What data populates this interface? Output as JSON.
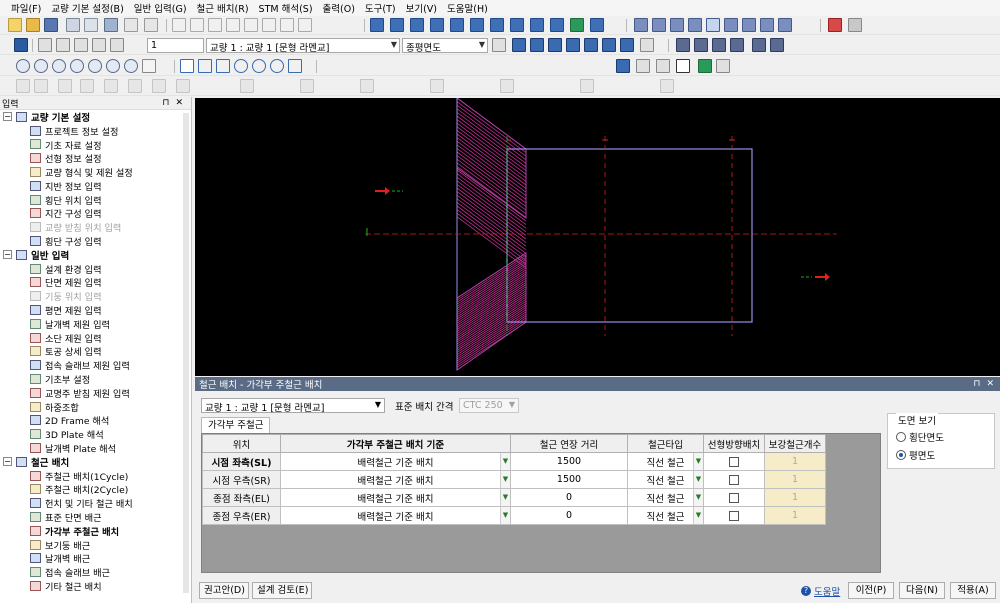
{
  "menubar": [
    "파일(F)",
    "교량 기본 설정(B)",
    "일반 입력(G)",
    "철근 배치(R)",
    "STM 해석(S)",
    "출력(O)",
    "도구(T)",
    "보기(V)",
    "도움말(H)"
  ],
  "toolbar2": {
    "number_value": "1",
    "bridge_select": "교량 1 : 교량 1 [문형 라멘교]",
    "view_select": "종평면도"
  },
  "left_panel": {
    "title": "입력",
    "groups": [
      {
        "label": "교량 기본 설정",
        "items": [
          {
            "label": "프로젝트 정보 설정",
            "disabled": false,
            "bold": false
          },
          {
            "label": "기초 자료 설정",
            "disabled": false,
            "bold": false
          },
          {
            "label": "선형 정보 설정",
            "disabled": false,
            "bold": false
          },
          {
            "label": "교량 형식 및 제원 설정",
            "disabled": false,
            "bold": false
          },
          {
            "label": "지반 정보 입력",
            "disabled": false,
            "bold": false
          },
          {
            "label": "횡단 위치 입력",
            "disabled": false,
            "bold": false
          },
          {
            "label": "지간 구성 입력",
            "disabled": false,
            "bold": false
          },
          {
            "label": "교량 받침 위치 입력",
            "disabled": true,
            "bold": false
          },
          {
            "label": "횡단 구성 입력",
            "disabled": false,
            "bold": false
          }
        ]
      },
      {
        "label": "일반 입력",
        "items": [
          {
            "label": "설계 환경 입력",
            "disabled": false,
            "bold": false
          },
          {
            "label": "단면 제원 입력",
            "disabled": false,
            "bold": false
          },
          {
            "label": "기둥 위치 입력",
            "disabled": true,
            "bold": false
          },
          {
            "label": "평면 제원 입력",
            "disabled": false,
            "bold": false
          },
          {
            "label": "날개벽 제원 입력",
            "disabled": false,
            "bold": false
          },
          {
            "label": "소단 제원 입력",
            "disabled": false,
            "bold": false
          },
          {
            "label": "토공 상세 입력",
            "disabled": false,
            "bold": false
          },
          {
            "label": "접속 슬래브 제원 입력",
            "disabled": false,
            "bold": false
          },
          {
            "label": "기초부 설정",
            "disabled": false,
            "bold": false
          },
          {
            "label": "교명주 받침 제원 입력",
            "disabled": false,
            "bold": false
          },
          {
            "label": "하중조합",
            "disabled": false,
            "bold": false
          },
          {
            "label": "2D Frame 해석",
            "disabled": false,
            "bold": false
          },
          {
            "label": "3D Plate 해석",
            "disabled": false,
            "bold": false
          },
          {
            "label": "날개벽 Plate 해석",
            "disabled": false,
            "bold": false
          }
        ]
      },
      {
        "label": "철근 배치",
        "items": [
          {
            "label": "주철근 배치(1Cycle)",
            "disabled": false,
            "bold": false
          },
          {
            "label": "주철근 배치(2Cycle)",
            "disabled": false,
            "bold": false
          },
          {
            "label": "헌치 및 기타 철근 배치",
            "disabled": false,
            "bold": false
          },
          {
            "label": "표준 단면 배근",
            "disabled": false,
            "bold": false
          },
          {
            "label": "가각부 주철근 배치",
            "disabled": false,
            "bold": true
          },
          {
            "label": "보기둥 배근",
            "disabled": false,
            "bold": false
          },
          {
            "label": "날개벽 배근",
            "disabled": false,
            "bold": false
          },
          {
            "label": "접속 슬래브 배근",
            "disabled": false,
            "bold": false
          },
          {
            "label": "기타 철근 배치",
            "disabled": false,
            "bold": false
          }
        ]
      }
    ]
  },
  "dialog": {
    "title": "철근 배치 - 가각부 주철근 배치",
    "bridge_select": "교량 1 : 교량 1 [문형 라멘교]",
    "spacing_label": "표준 배치 간격",
    "spacing_value": "CTC 250",
    "tab": "가각부 주철근",
    "columns": [
      "위치",
      "가각부 주철근 배치 기준",
      "철근 연장 거리",
      "철근타입",
      "선형방향배치",
      "보강철근개수"
    ],
    "rows": [
      {
        "pos": "시점 좌측(SL)",
        "basis": "배력철근 기준 배치",
        "ext": "1500",
        "type": "직선 철근",
        "count": "1",
        "bold": true
      },
      {
        "pos": "시점 우측(SR)",
        "basis": "배력철근 기준 배치",
        "ext": "1500",
        "type": "직선 철근",
        "count": "1",
        "bold": false
      },
      {
        "pos": "종점 좌측(EL)",
        "basis": "배력철근 기준 배치",
        "ext": "0",
        "type": "직선 철근",
        "count": "1",
        "bold": false
      },
      {
        "pos": "종점 우측(ER)",
        "basis": "배력철근 기준 배치",
        "ext": "0",
        "type": "직선 철근",
        "count": "1",
        "bold": false
      }
    ],
    "view_group": {
      "label": "도면 보기",
      "opt1": "횡단면도",
      "opt2": "평면도",
      "selected": "평면도"
    },
    "buttons": {
      "recommend": "권고안(D)",
      "review": "설계 검토(E)",
      "help": "도움말",
      "prev": "이전(P)",
      "next": "다음(N)",
      "apply": "적용(A)"
    }
  },
  "colors": {
    "canvas_bg": "#000000",
    "outline": "#9a8ee8",
    "hatch": "#c03090",
    "centerline": "#d02020",
    "axis_green": "#20b020",
    "selection_blue": "#1b55a8"
  }
}
